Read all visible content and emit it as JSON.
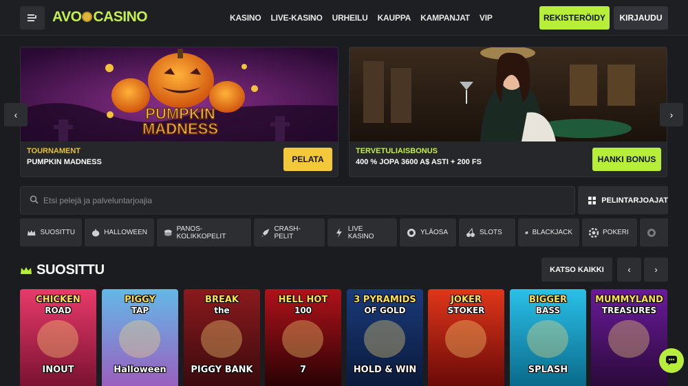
{
  "header": {
    "logo_left": "AVO",
    "logo_right": "CASINO",
    "nav": [
      "KASINO",
      "LIVE-KASINO",
      "URHEILU",
      "KAUPPA",
      "KAMPANJAT",
      "VIP"
    ],
    "register": "REKISTERÖIDY",
    "login": "KIRJAUDU"
  },
  "banners": [
    {
      "kicker": "TOURNAMENT",
      "title": "PUMPKIN MADNESS",
      "cta": "PELATA",
      "art_line1": "PUMPKIN",
      "art_line2": "MADNESS"
    },
    {
      "kicker": "TERVETULIAISBONUS",
      "title": "400 % JOPA 3600 A$ ASTI + 200 FS",
      "cta": "HANKI BONUS"
    }
  ],
  "search": {
    "placeholder": "Etsi pelejä ja palveluntarjoajia",
    "providers": "PELINTARJOAJAT"
  },
  "categories": [
    {
      "label": "SUOSITTU",
      "icon": "crown-icon"
    },
    {
      "label": "HALLOWEEN",
      "icon": "pumpkin-icon"
    },
    {
      "label": "PANOS-KOLIKKOPELIT",
      "icon": "coins-icon"
    },
    {
      "label": "CRASH-PELIT",
      "icon": "rocket-icon"
    },
    {
      "label": "LIVE KASINO",
      "icon": "lightning-icon"
    },
    {
      "label": "YLÄOSA",
      "icon": "star-badge-icon"
    },
    {
      "label": "SLOTS",
      "icon": "cherry-icon"
    },
    {
      "label": "BLACKJACK",
      "icon": "cards-icon"
    },
    {
      "label": "POKERI",
      "icon": "chip-icon"
    },
    {
      "label": "",
      "icon": "roulette-icon"
    }
  ],
  "section": {
    "title": "SUOSITTU",
    "see_all": "KATSO KAIKKI"
  },
  "games": [
    {
      "l1": "CHICKEN",
      "l2": "ROAD",
      "l3": "INOUT",
      "bg": "#e83a6a",
      "bg2": "#7a1232"
    },
    {
      "l1": "PIGGY",
      "l2": "TAP",
      "l3": "Halloween",
      "bg": "#63b8e8",
      "bg2": "#9a5fbf"
    },
    {
      "l1": "BREAK",
      "l2": "the",
      "l3": "PIGGY BANK",
      "bg": "#8a1a1e",
      "bg2": "#3a0a0c"
    },
    {
      "l1": "HELL HOT",
      "l2": "100",
      "l3": "7",
      "bg": "#b0121a",
      "bg2": "#2a0204"
    },
    {
      "l1": "3 PYRAMIDS",
      "l2": "OF GOLD",
      "l3": "HOLD & WIN",
      "bg": "#1a3a7a",
      "bg2": "#0a1a3a"
    },
    {
      "l1": "JOKER",
      "l2": "STOKER",
      "l3": "",
      "bg": "#e0361a",
      "bg2": "#6a0a08"
    },
    {
      "l1": "BIGGER",
      "l2": "BASS",
      "l3": "SPLASH",
      "bg": "#2ac0e8",
      "bg2": "#0a6a8a"
    },
    {
      "l1": "MUMMYLAND",
      "l2": "TREASURES",
      "l3": "",
      "bg": "#6a1a9a",
      "bg2": "#2a0a3a"
    }
  ]
}
